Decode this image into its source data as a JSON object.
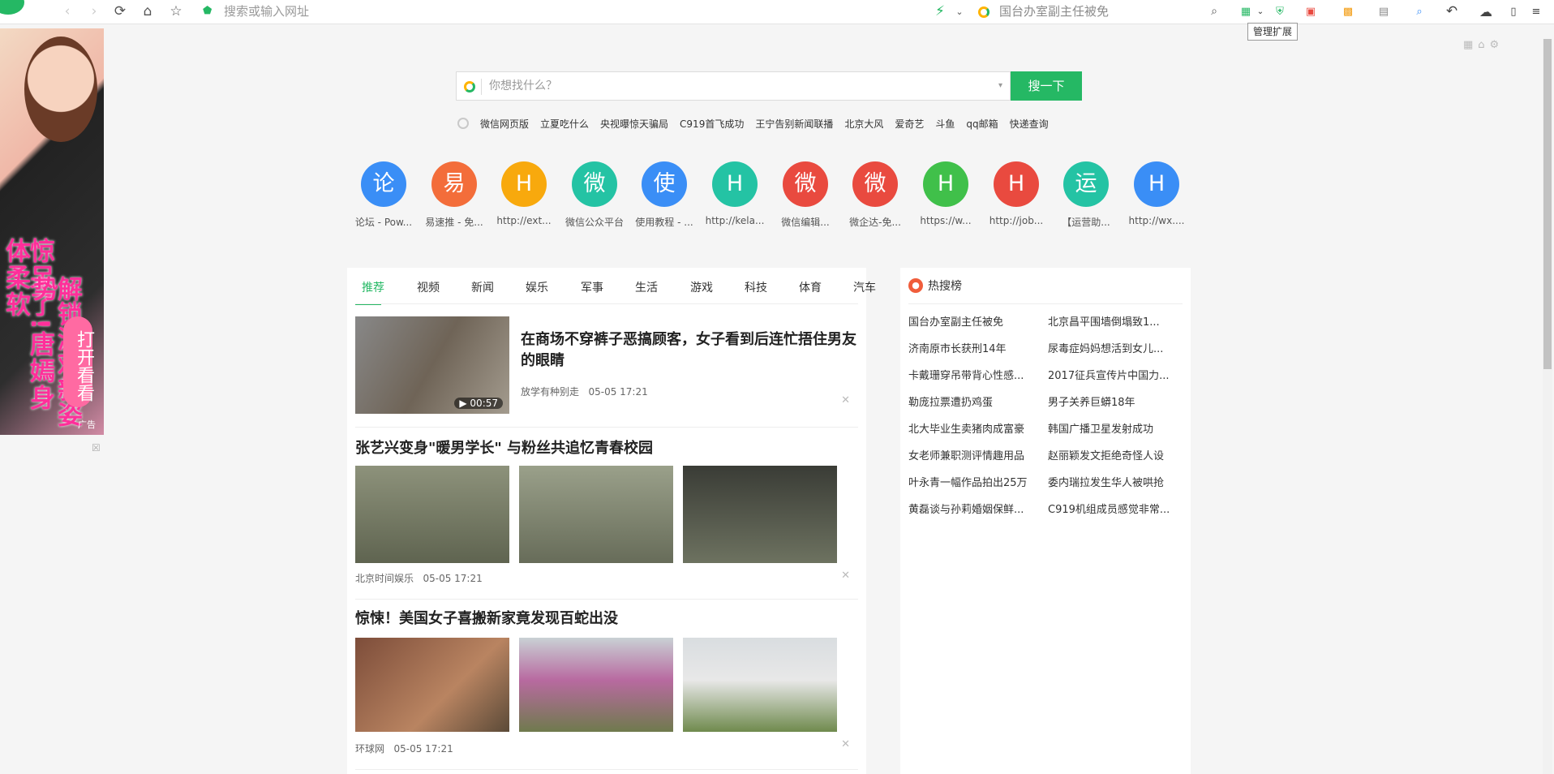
{
  "toolbar": {
    "url_placeholder": "搜索或输入网址",
    "search_text": "国台办室副主任被免",
    "tooltip": "管理扩展"
  },
  "ad": {
    "line1": "惊呆了!唐嫣身体柔软",
    "line2": "解锁游戏新姿势",
    "cta": "打开看看",
    "tag": "广告"
  },
  "search": {
    "placeholder": "你想找什么？",
    "button": "搜一下",
    "hotwords": [
      "微信网页版",
      "立夏吃什么",
      "央视曝惊天骗局",
      "C919首飞成功",
      "王宁告别新闻联播",
      "北京大风",
      "爱奇艺",
      "斗鱼",
      "qq邮箱",
      "快递查询"
    ]
  },
  "apps": [
    {
      "glyph": "论",
      "label": "论坛 - Pow...",
      "color": "#3a8ef6"
    },
    {
      "glyph": "易",
      "label": "易速推 - 免...",
      "color": "#f36d3a"
    },
    {
      "glyph": "H",
      "label": "http://ext...",
      "color": "#f8a90d"
    },
    {
      "glyph": "微",
      "label": "微信公众平台",
      "color": "#24c3a4"
    },
    {
      "glyph": "使",
      "label": "使用教程 - ...",
      "color": "#3a8ef6"
    },
    {
      "glyph": "H",
      "label": "http://kela...",
      "color": "#24c3a4"
    },
    {
      "glyph": "微",
      "label": "微信编辑...",
      "color": "#e94a3f"
    },
    {
      "glyph": "微",
      "label": "微企达-免...",
      "color": "#e94a3f"
    },
    {
      "glyph": "H",
      "label": "https://w...",
      "color": "#40c04a"
    },
    {
      "glyph": "H",
      "label": "http://job...",
      "color": "#e94a3f"
    },
    {
      "glyph": "运",
      "label": "【运营助...",
      "color": "#24c3a4"
    },
    {
      "glyph": "H",
      "label": "http://wx....",
      "color": "#3a8ef6"
    }
  ],
  "tabs": [
    "推荐",
    "视频",
    "新闻",
    "娱乐",
    "军事",
    "生活",
    "游戏",
    "科技",
    "体育",
    "汽车"
  ],
  "feed": [
    {
      "title": "在商场不穿裤子恶搞顾客，女子看到后连忙捂住男友的眼睛",
      "source": "放学有种别走",
      "time": "05-05 17:21",
      "duration": "▶ 00:57"
    },
    {
      "title": "张艺兴变身\"暖男学长\" 与粉丝共追忆青春校园",
      "source": "北京时间娱乐",
      "time": "05-05 17:21"
    },
    {
      "title": "惊悚！美国女子喜搬新家竟发现百蛇出没",
      "source": "环球网",
      "time": "05-05 17:21"
    }
  ],
  "hot": {
    "title": "热搜榜",
    "items": [
      "国台办室副主任被免",
      "北京昌平围墙倒塌致1...",
      "济南原市长获刑14年",
      "尿毒症妈妈想活到女儿...",
      "卡戴珊穿吊带背心性感...",
      "2017征兵宣传片中国力...",
      "勒庞拉票遭扔鸡蛋",
      "男子关养巨蟒18年",
      "北大毕业生卖猪肉成富豪",
      "韩国广播卫星发射成功",
      "女老师兼职测评情趣用品",
      "赵丽颖发文拒绝奇怪人设",
      "叶永青一幅作品拍出25万",
      "委内瑞拉发生华人被哄抢",
      "黄磊谈与孙莉婚姻保鲜...",
      "C919机组成员感觉非常..."
    ]
  }
}
